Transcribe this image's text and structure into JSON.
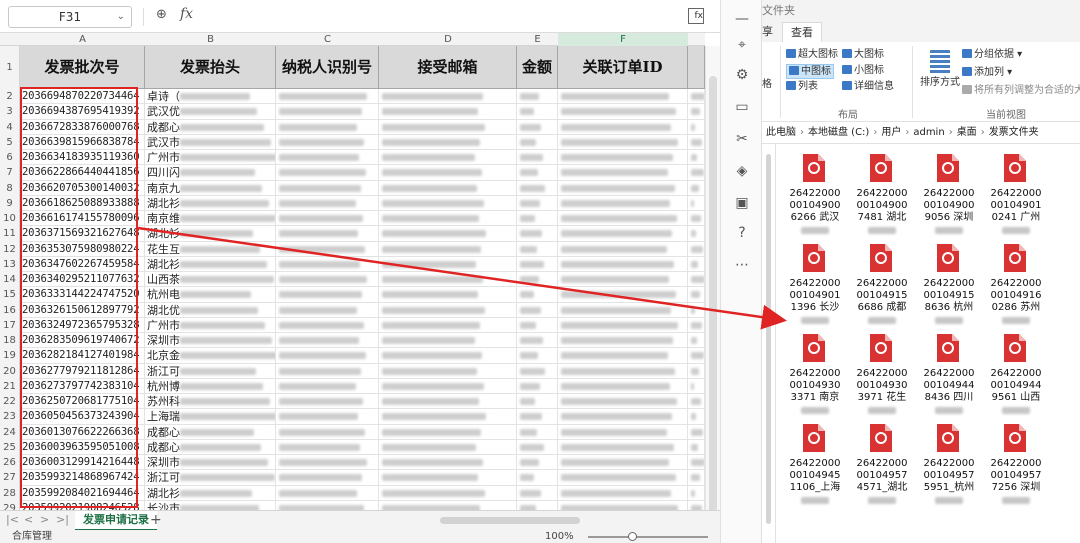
{
  "formula_bar": {
    "name_box": "F31",
    "fx_label": "fx"
  },
  "sheet": {
    "column_letters": [
      "A",
      "B",
      "C",
      "D",
      "E",
      "F"
    ],
    "row_numbers": [
      "1",
      "2",
      "3",
      "4",
      "5",
      "6",
      "7",
      "8",
      "9",
      "10",
      "11",
      "12",
      "13",
      "14",
      "15",
      "16",
      "17",
      "18",
      "19",
      "20",
      "21",
      "22",
      "23",
      "24",
      "25",
      "26",
      "27",
      "28",
      "29"
    ],
    "headers": [
      "发票批次号",
      "发票抬头",
      "纳税人识别号",
      "接受邮箱",
      "金额",
      "关联订单ID"
    ],
    "batch_numbers": [
      "203669487022073446​4",
      "2036694387695419392",
      "2036672833876000768",
      "2036639815966838784",
      "2036634183935119360",
      "2036622866440441856",
      "2036620705300140032",
      "2036618625088933888",
      "2036616174155780096",
      "2036371569321627648",
      "2036353075980980224",
      "2036347602267459584",
      "2036340295211077632",
      "2036333144224747520",
      "2036326150612897792",
      "2036324972365795328",
      "2036283509619740672",
      "2036282184127401984",
      "2036277979211812864",
      "2036273797742383104",
      "2036250720681775104",
      "2036050456373243904",
      "2036013076622266368",
      "2036003963595051008",
      "2036003129914216448",
      "2035993214868967424",
      "2035992084021694464",
      "2035992021908246528"
    ],
    "titles_visible": [
      "卓诗（",
      "武汉优",
      "成都心",
      "武汉市",
      "广州市",
      "四川闪",
      "南京九",
      "湖北衫",
      "南京维",
      "湖北衫",
      "花生互",
      "湖北衫",
      "山西茶",
      "杭州电",
      "湖北优",
      "广州市",
      "深圳市",
      "北京金",
      "浙江可",
      "杭州博",
      "苏州科",
      "上海瑞",
      "成都心",
      "成都心",
      "深圳市",
      "浙江可",
      "湖北衫",
      "长沙市"
    ],
    "sheet_tab": "发票申请记录",
    "add_tab": "+"
  },
  "status_bar": {
    "left": "合库管理",
    "zoom": "100%"
  },
  "explorer": {
    "window_title": "文件夹",
    "ribbon_tab_left": "享",
    "ribbon_tab_active": "查看",
    "layout_options": [
      "超大图标",
      "大图标",
      "中图标",
      "小图标",
      "列表",
      "详细信息"
    ],
    "left_cut_label": "格",
    "sort_label": "排序方式",
    "group_by": "分组依据",
    "add_column": "添加列",
    "fit_columns": "将所有列调整为合适的大",
    "group_layout": "布局",
    "group_current_view": "当前视图",
    "breadcrumb": [
      "此电脑",
      "本地磁盘 (C:)",
      "用户",
      "admin",
      "桌面",
      "发票文件夹"
    ],
    "files": [
      {
        "l1": "26422000",
        "l2": "00104900",
        "l3": "6266 武汉"
      },
      {
        "l1": "26422000",
        "l2": "00104900",
        "l3": "7481 湖北"
      },
      {
        "l1": "26422000",
        "l2": "00104900",
        "l3": "9056 深圳"
      },
      {
        "l1": "26422000",
        "l2": "00104901",
        "l3": "0241 广州"
      },
      {
        "l1": "26422000",
        "l2": "00104901",
        "l3": "1396 长沙"
      },
      {
        "l1": "26422000",
        "l2": "00104915",
        "l3": "6686 成都"
      },
      {
        "l1": "26422000",
        "l2": "00104915",
        "l3": "8636 杭州"
      },
      {
        "l1": "26422000",
        "l2": "00104916",
        "l3": "0286 苏州"
      },
      {
        "l1": "26422000",
        "l2": "00104930",
        "l3": "3371 南京"
      },
      {
        "l1": "26422000",
        "l2": "00104930",
        "l3": "3971 花生"
      },
      {
        "l1": "26422000",
        "l2": "00104944",
        "l3": "8436 四川"
      },
      {
        "l1": "26422000",
        "l2": "00104944",
        "l3": "9561 山西"
      },
      {
        "l1": "26422000",
        "l2": "00104945",
        "l3": "1106_上海"
      },
      {
        "l1": "26422000",
        "l2": "00104957",
        "l3": "4571_湖北"
      },
      {
        "l1": "26422000",
        "l2": "00104957",
        "l3": "5951_杭州"
      },
      {
        "l1": "26422000",
        "l2": "00104957",
        "l3": "7256 深圳"
      }
    ]
  },
  "colors": {
    "highlight_red": "#e02424",
    "sheet_tab_green": "#1e7145",
    "pdf_red": "#d93232"
  }
}
